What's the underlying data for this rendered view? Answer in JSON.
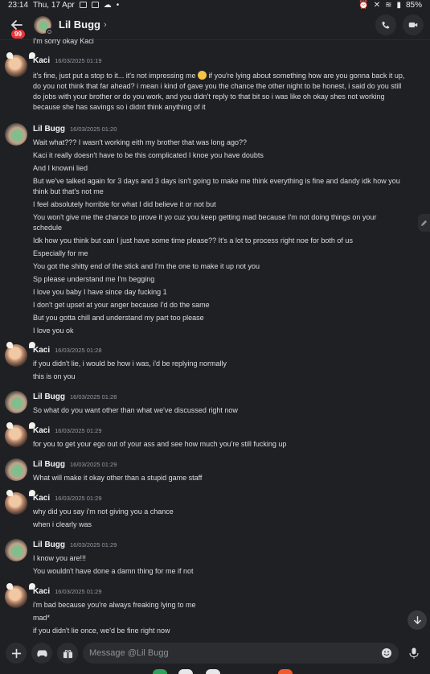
{
  "status_bar": {
    "time": "23:14",
    "date": "Thu, 17 Apr",
    "battery": "85%"
  },
  "header": {
    "back_badge": "99",
    "title": "Lil Bugg",
    "title_chevron": "›"
  },
  "first_line": "I'm sorry okay Kaci",
  "groups": [
    {
      "author": "Kaci",
      "time": "16/03/2025 01:19",
      "avatar": "kaci",
      "lines": [
        "it's fine, just put a stop to it... it's not impressing me",
        "if you're lying about something how are you gonna back it up,",
        "do you not think that far ahead? i mean i kind of gave you the chance the other night to be honest, i said do you still",
        "do jobs with your brother or do you work, and you didn't reply to that bit so i was like oh okay shes not working",
        "because she has savings so i didnt think anything of it"
      ]
    },
    {
      "author": "Lil Bugg",
      "time": "16/03/2025 01:20",
      "avatar": "bugg",
      "lines": [
        "Wait what??? I wasn't working eith my brother that was long ago??",
        "Kaci it really doesn't have to be this complicated I knoe you have doubts",
        "And I knowni lied",
        "But we've talked again for 3 days and 3 days isn't going to make me think everything is fine and dandy idk how you",
        "think but that's not me",
        "I feel absolutely horrible for what I did believe it or not but",
        "You won't give me the chance to prove it yo cuz you keep getting mad because I'm not doing things on your",
        "schedule",
        "Idk how you think but can I just have some time please?? It's a lot to process right noe for both of us",
        "Especially for me",
        "You got the shitty end of the stick and I'm the one to make it up not you",
        "Sp please understand me I'm begging",
        "I love you baby I have since day fucking 1",
        "I don't get upset at your anger because I'd do the same",
        "But you gotta chill and understand my part too please",
        "I love you ok"
      ]
    },
    {
      "author": "Kaci",
      "time": "16/03/2025 01:28",
      "avatar": "kaci",
      "lines": [
        "if you didn't lie, i would be how i was, i'd be replying normally",
        "this is on you"
      ]
    },
    {
      "author": "Lil Bugg",
      "time": "16/03/2025 01:28",
      "avatar": "bugg",
      "lines": [
        "So what do you want other than what we've discussed right now"
      ]
    },
    {
      "author": "Kaci",
      "time": "16/03/2025 01:29",
      "avatar": "kaci",
      "lines": [
        "for you to get your ego out of your ass and see how much you're still fucking up"
      ]
    },
    {
      "author": "Lil Bugg",
      "time": "16/03/2025 01:29",
      "avatar": "bugg",
      "lines": [
        "What will make it okay other than a stupid game staff"
      ]
    },
    {
      "author": "Kaci",
      "time": "16/03/2025 01:29",
      "avatar": "kaci",
      "lines": [
        "why did you say i'm not giving you a chance",
        "when i clearly was"
      ]
    },
    {
      "author": "Lil Bugg",
      "time": "16/03/2025 01:29",
      "avatar": "bugg",
      "lines": [
        "I know you are!!!",
        "You wouldn't have done a damn thing for me if not"
      ]
    },
    {
      "author": "Kaci",
      "time": "16/03/2025 01:29",
      "avatar": "kaci",
      "lines": [
        "i'm bad because you're always freaking lying to me",
        "mad*",
        "if you didn't lie once, we'd be fine right now"
      ]
    }
  ],
  "composer": {
    "placeholder": "Message @Lil Bugg"
  },
  "colors": {
    "background": "#1f2024",
    "input": "#2b2d31",
    "badge": "#e5383b"
  }
}
